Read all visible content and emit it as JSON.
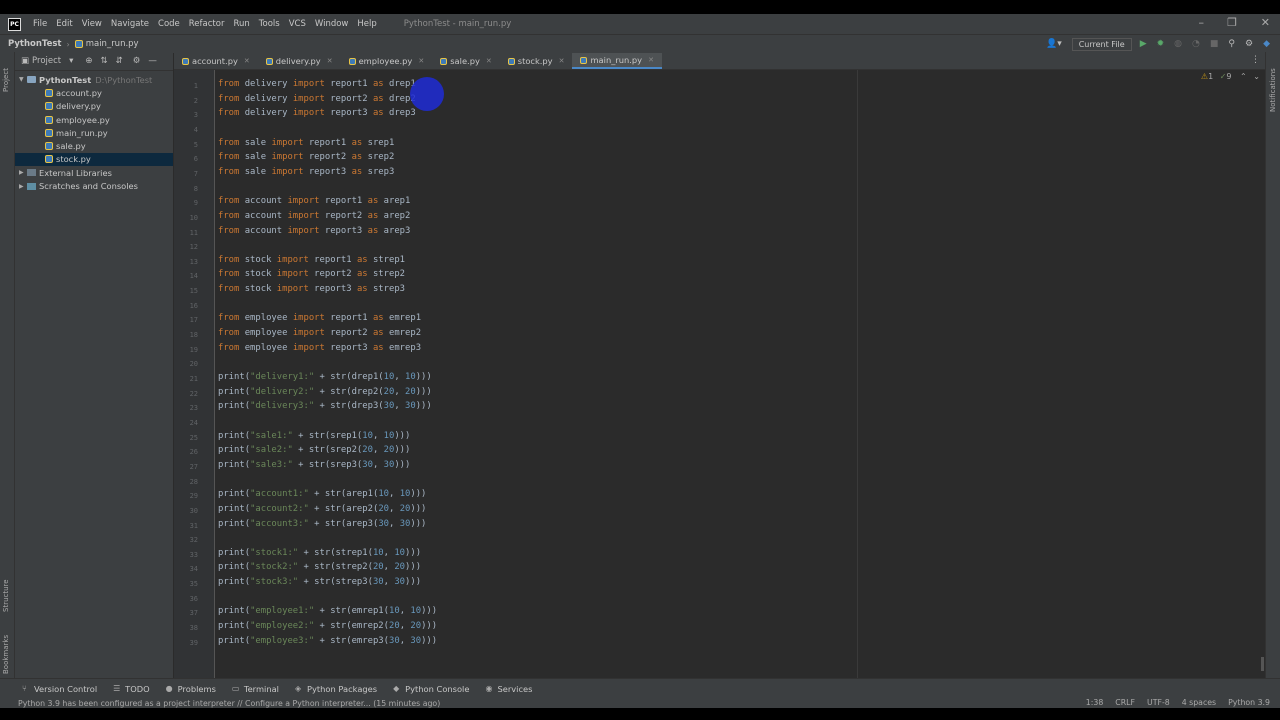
{
  "menubar": {
    "items": [
      "File",
      "Edit",
      "View",
      "Navigate",
      "Code",
      "Refactor",
      "Run",
      "Tools",
      "VCS",
      "Window",
      "Help"
    ],
    "window_title": "PythonTest - main_run.py"
  },
  "navbar": {
    "project": "PythonTest",
    "file": "main_run.py",
    "run_config": "Current File"
  },
  "project_panel": {
    "header": "Project",
    "root": {
      "name": "PythonTest",
      "path": "D:\\PythonTest"
    },
    "files": [
      "account.py",
      "delivery.py",
      "employee.py",
      "main_run.py",
      "sale.py",
      "stock.py"
    ],
    "selected_file": "stock.py",
    "external_libraries": "External Libraries",
    "scratches": "Scratches and Consoles"
  },
  "tabs": [
    "account.py",
    "delivery.py",
    "employee.py",
    "sale.py",
    "stock.py",
    "main_run.py"
  ],
  "active_tab": "main_run.py",
  "editor": {
    "indicators": {
      "warnings": "1",
      "weak_warnings": "9"
    },
    "lines": [
      {
        "n": "1",
        "text": "from delivery import report1 as drep1"
      },
      {
        "n": "2",
        "text": "from delivery import report2 as drep2"
      },
      {
        "n": "3",
        "text": "from delivery import report3 as drep3"
      },
      {
        "n": "4",
        "text": ""
      },
      {
        "n": "5",
        "text": "from sale import report1 as srep1"
      },
      {
        "n": "6",
        "text": "from sale import report2 as srep2"
      },
      {
        "n": "7",
        "text": "from sale import report3 as srep3"
      },
      {
        "n": "8",
        "text": ""
      },
      {
        "n": "9",
        "text": "from account import report1 as arep1"
      },
      {
        "n": "10",
        "text": "from account import report2 as arep2"
      },
      {
        "n": "11",
        "text": "from account import report3 as arep3"
      },
      {
        "n": "12",
        "text": ""
      },
      {
        "n": "13",
        "text": "from stock import report1 as strep1"
      },
      {
        "n": "14",
        "text": "from stock import report2 as strep2"
      },
      {
        "n": "15",
        "text": "from stock import report3 as strep3"
      },
      {
        "n": "16",
        "text": ""
      },
      {
        "n": "17",
        "text": "from employee import report1 as emrep1"
      },
      {
        "n": "18",
        "text": "from employee import report2 as emrep2"
      },
      {
        "n": "19",
        "text": "from employee import report3 as emrep3"
      },
      {
        "n": "20",
        "text": ""
      },
      {
        "n": "21",
        "text": "print(\"delivery1:\" + str(drep1(10, 10)))"
      },
      {
        "n": "22",
        "text": "print(\"delivery2:\" + str(drep2(20, 20)))"
      },
      {
        "n": "23",
        "text": "print(\"delivery3:\" + str(drep3(30, 30)))"
      },
      {
        "n": "24",
        "text": ""
      },
      {
        "n": "25",
        "text": "print(\"sale1:\" + str(srep1(10, 10)))"
      },
      {
        "n": "26",
        "text": "print(\"sale2:\" + str(srep2(20, 20)))"
      },
      {
        "n": "27",
        "text": "print(\"sale3:\" + str(srep3(30, 30)))"
      },
      {
        "n": "28",
        "text": ""
      },
      {
        "n": "29",
        "text": "print(\"account1:\" + str(arep1(10, 10)))"
      },
      {
        "n": "30",
        "text": "print(\"account2:\" + str(arep2(20, 20)))"
      },
      {
        "n": "31",
        "text": "print(\"account3:\" + str(arep3(30, 30)))"
      },
      {
        "n": "32",
        "text": ""
      },
      {
        "n": "33",
        "text": "print(\"stock1:\" + str(strep1(10, 10)))"
      },
      {
        "n": "34",
        "text": "print(\"stock2:\" + str(strep2(20, 20)))"
      },
      {
        "n": "35",
        "text": "print(\"stock3:\" + str(strep3(30, 30)))"
      },
      {
        "n": "36",
        "text": ""
      },
      {
        "n": "37",
        "text": "print(\"employee1:\" + str(emrep1(10, 10)))"
      },
      {
        "n": "38",
        "text": "print(\"employee2:\" + str(emrep2(20, 20)))"
      },
      {
        "n": "39",
        "text": "print(\"employee3:\" + str(emrep3(30, 30)))"
      }
    ]
  },
  "toolwindows": [
    "Version Control",
    "TODO",
    "Problems",
    "Terminal",
    "Python Packages",
    "Python Console",
    "Services"
  ],
  "side_labels": {
    "project": "Project",
    "structure": "Structure",
    "bookmarks": "Bookmarks",
    "notifications": "Notifications"
  },
  "statusbar": {
    "message": "Python 3.9 has been configured as a project interpreter // Configure a Python interpreter... (15 minutes ago)",
    "position": "1:38",
    "line_sep": "CRLF",
    "encoding": "UTF-8",
    "indent": "4 spaces",
    "interpreter": "Python 3.9"
  },
  "colors": {
    "keyword": "#cc7832",
    "string": "#6a8759",
    "number": "#6897bb",
    "text": "#a9b7c6",
    "accent": "#4a88c7"
  }
}
